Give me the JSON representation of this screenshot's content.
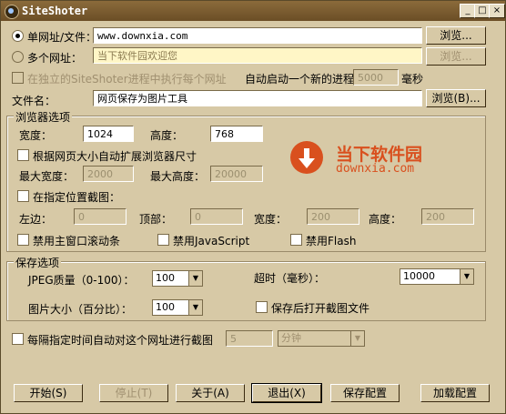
{
  "window": {
    "title": "SiteShoter"
  },
  "mode": {
    "single_label": "单网址/文件：",
    "single_value": "www.downxia.com",
    "multi_label": "多个网址：",
    "multi_placeholder": "当下软件园欢迎您",
    "separate_process_label": "在独立的SiteShoter进程中执行每个网址",
    "auto_start_label": "自动启动一个新的进程：",
    "auto_start_value": "5000",
    "auto_start_unit": "毫秒",
    "browse1": "浏览...",
    "browse2": "浏览..."
  },
  "filename": {
    "label": "文件名：",
    "value": "网页保存为图片工具",
    "browse": "浏览(B)..."
  },
  "browser": {
    "group_label": "浏览器选项",
    "width_label": "宽度：",
    "width_value": "1024",
    "height_label": "高度：",
    "height_value": "768",
    "auto_expand_label": "根据网页大小自动扩展浏览器尺寸",
    "max_width_label": "最大宽度：",
    "max_width_value": "2000",
    "max_height_label": "最大高度：",
    "max_height_value": "20000",
    "capture_region_label": "在指定位置截图：",
    "left_label": "左边：",
    "left_value": "0",
    "top_label": "顶部：",
    "top_value": "0",
    "rwidth_label": "宽度：",
    "rwidth_value": "200",
    "rheight_label": "高度：",
    "rheight_value": "200",
    "disable_scroll_label": "禁用主窗口滚动条",
    "disable_js_label": "禁用JavaScript",
    "disable_flash_label": "禁用Flash"
  },
  "logo": {
    "cn": "当下软件园",
    "en": "downxia.com"
  },
  "save": {
    "group_label": "保存选项",
    "jpeg_label": "JPEG质量（0-100）：",
    "jpeg_value": "100",
    "size_label": "图片大小（百分比）：",
    "size_value": "100",
    "timeout_label": "超时（毫秒）：",
    "timeout_value": "10000",
    "open_after_label": "保存后打开截图文件"
  },
  "schedule": {
    "label": "每隔指定时间自动对这个网址进行截图",
    "value": "5",
    "unit": "分钟"
  },
  "buttons": {
    "start": "开始(S)",
    "stop": "停止(T)",
    "about": "关于(A)",
    "exit": "退出(X)",
    "save_config": "保存配置",
    "load_config": "加载配置"
  }
}
